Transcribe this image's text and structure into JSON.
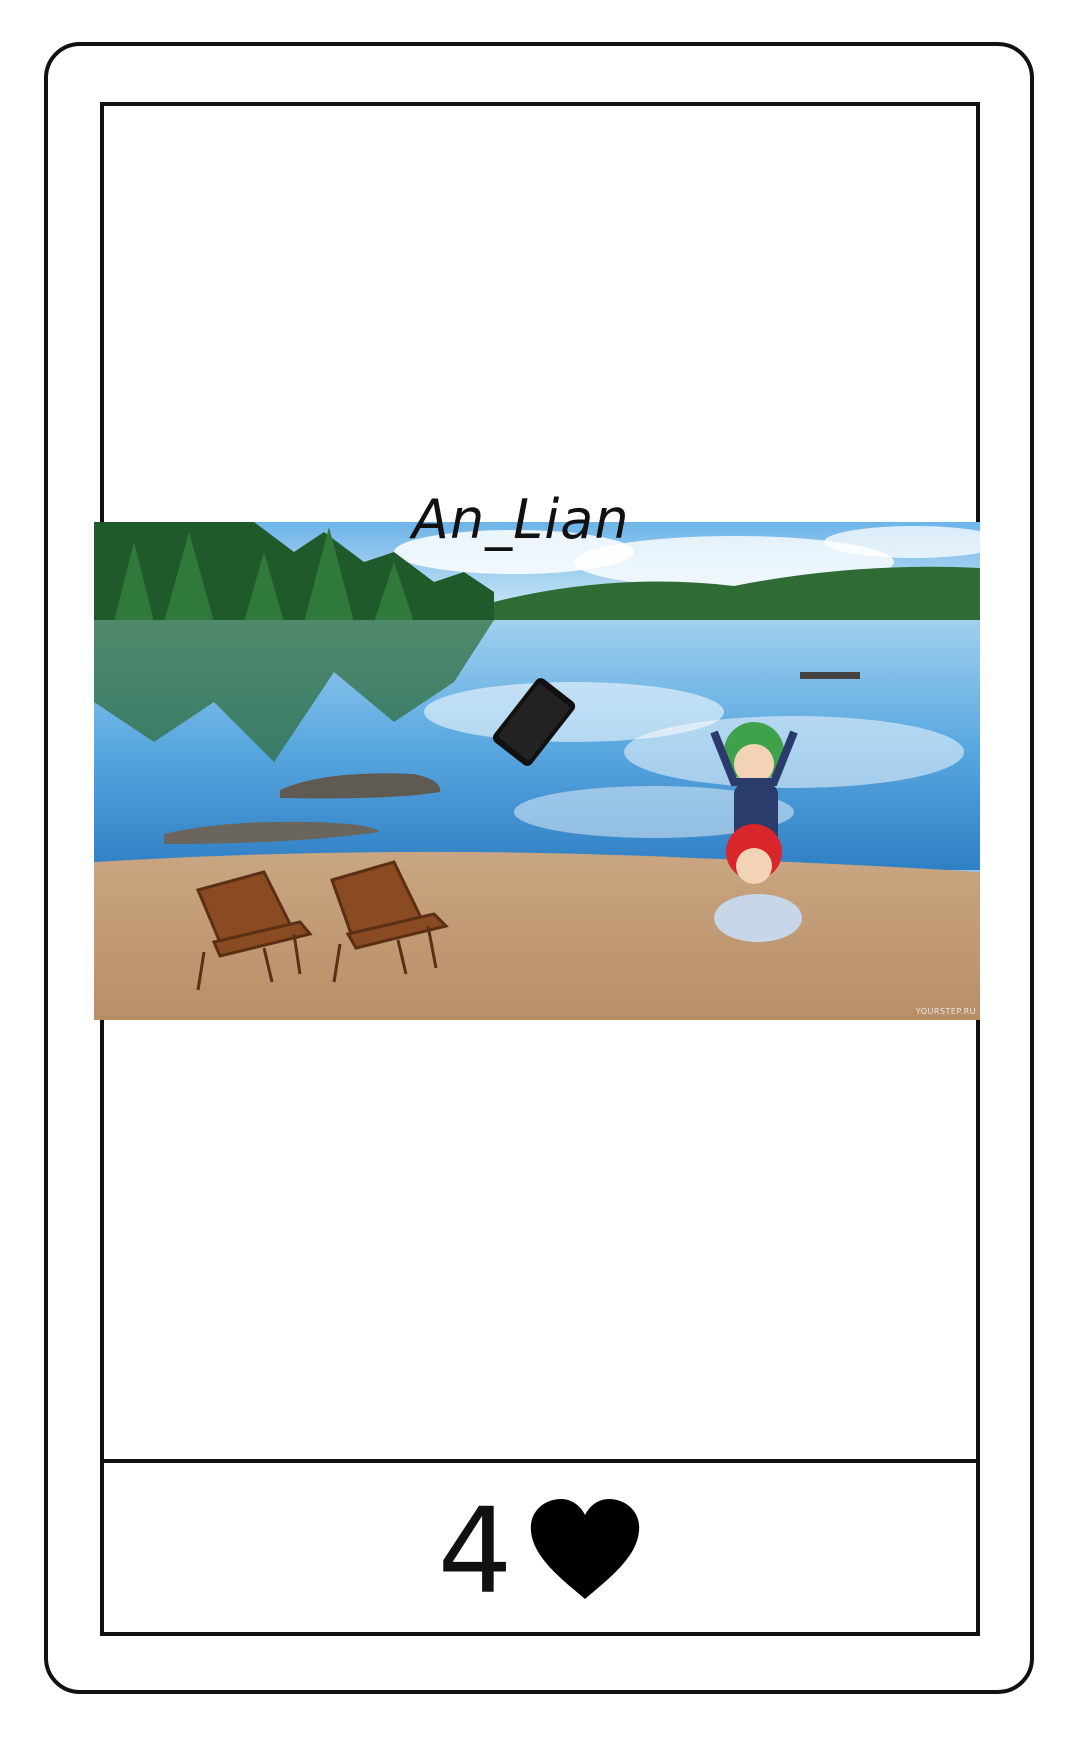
{
  "post": {
    "caption": "An_Lian",
    "likes": "4",
    "like_icon": "heart-icon",
    "image_description_icon": "lake-beach-photo",
    "watermark": "YOURSTEP.RU"
  },
  "colors": {
    "frame": "#111111",
    "background": "#ffffff",
    "heart": "#000000"
  }
}
